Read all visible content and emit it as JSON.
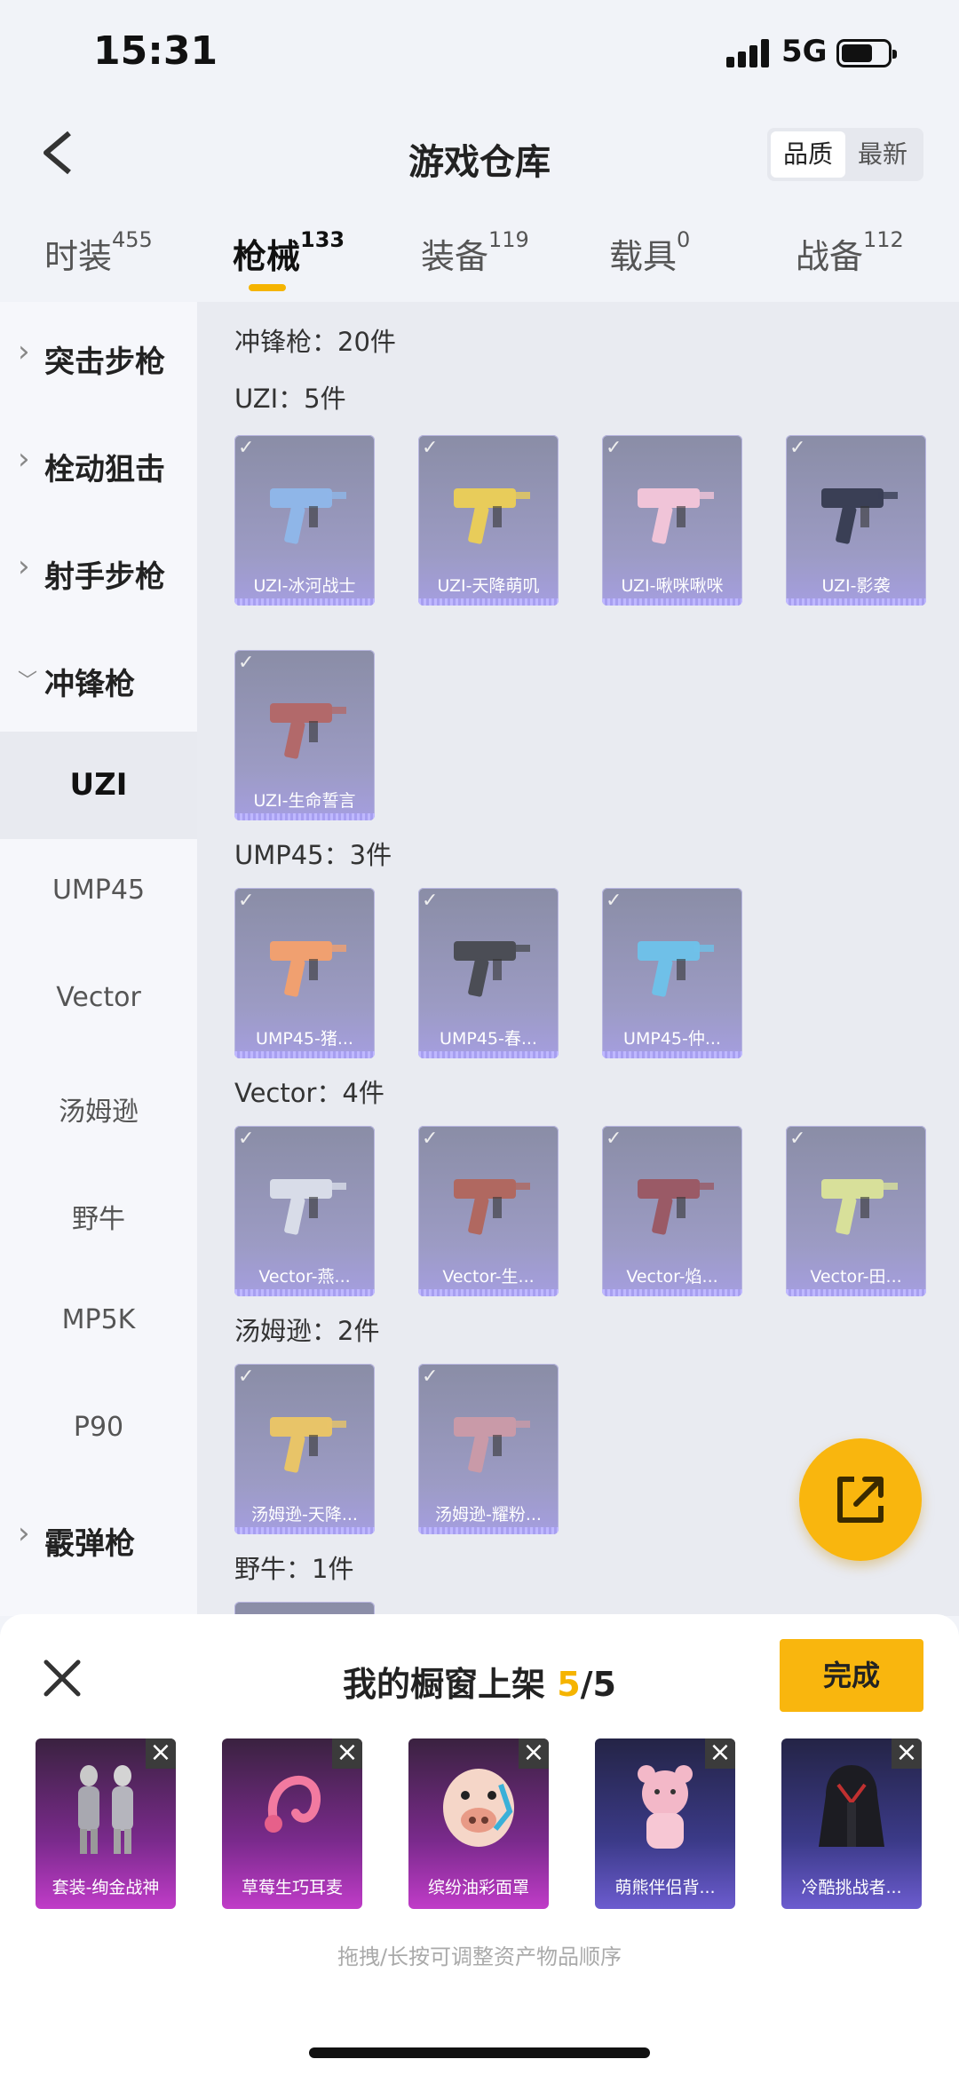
{
  "status": {
    "time": "15:31",
    "network": "5G"
  },
  "header": {
    "title": "游戏仓库",
    "sort": [
      "品质",
      "最新"
    ]
  },
  "tabs": [
    {
      "label": "时装",
      "count": "455"
    },
    {
      "label": "枪械",
      "count": "133"
    },
    {
      "label": "装备",
      "count": "119"
    },
    {
      "label": "载具",
      "count": "0"
    },
    {
      "label": "战备",
      "count": "112"
    }
  ],
  "sidebar": [
    {
      "label": "突击步枪",
      "type": "group"
    },
    {
      "label": "栓动狙击",
      "type": "group"
    },
    {
      "label": "射手步枪",
      "type": "group"
    },
    {
      "label": "冲锋枪",
      "type": "group-open"
    },
    {
      "label": "UZI",
      "type": "sub-selected"
    },
    {
      "label": "UMP45",
      "type": "sub"
    },
    {
      "label": "Vector",
      "type": "sub"
    },
    {
      "label": "汤姆逊",
      "type": "sub"
    },
    {
      "label": "野牛",
      "type": "sub"
    },
    {
      "label": "MP5K",
      "type": "sub"
    },
    {
      "label": "P90",
      "type": "sub"
    },
    {
      "label": "霰弹枪",
      "type": "group"
    }
  ],
  "main": {
    "category_header": "冲锋枪：20件",
    "sections": [
      {
        "header": "UZI：5件",
        "items": [
          "UZI-冰河战士",
          "UZI-天降萌叽",
          "UZI-啾咪啾咪",
          "UZI-影袭",
          "UZI-生命誓言"
        ]
      },
      {
        "header": "UMP45：3件",
        "items": [
          "UMP45-猪...",
          "UMP45-春...",
          "UMP45-仲..."
        ]
      },
      {
        "header": "Vector：4件",
        "items": [
          "Vector-燕...",
          "Vector-生...",
          "Vector-焰...",
          "Vector-田..."
        ]
      },
      {
        "header": "汤姆逊：2件",
        "items": [
          "汤姆逊-天降...",
          "汤姆逊-耀粉..."
        ]
      },
      {
        "header": "野牛：1件",
        "items": []
      }
    ]
  },
  "gun_colors": [
    "#8fb6e8",
    "#e8cc5a",
    "#f0c4d8",
    "#3a3f55",
    "#b2696a",
    "#f0a070",
    "#4b4d55",
    "#6fc0e8",
    "#d8dce8",
    "#b06860",
    "#9a5a66",
    "#d8e09a",
    "#e8c468",
    "#c99aa8"
  ],
  "sheet": {
    "title_prefix": "我的橱窗上架 ",
    "count": "5",
    "total": "/5",
    "done": "完成",
    "items": [
      "套装-绚金战神",
      "草莓生巧耳麦",
      "缤纷油彩面罩",
      "萌熊伴侣背...",
      "冷酷挑战者..."
    ],
    "hint": "拖拽/长按可调整资产物品顺序"
  }
}
